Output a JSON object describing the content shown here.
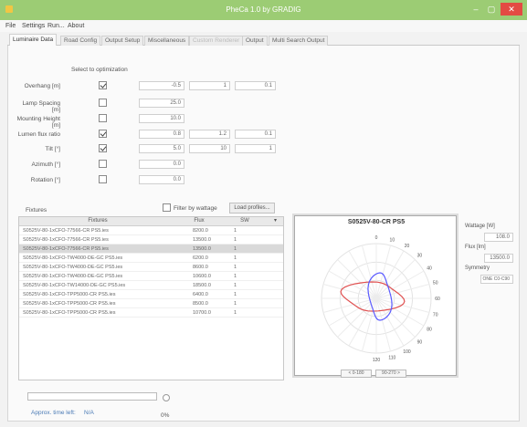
{
  "window": {
    "title": "PheCa 1.0 by GRADIG",
    "min_glyph": "–",
    "max_glyph": "▢",
    "close_glyph": "✕",
    "accent": "#9ccc74"
  },
  "menu": [
    "File",
    "Settings",
    "Run...",
    "About"
  ],
  "tabs": [
    {
      "label": "Luminaire Data",
      "active": true,
      "disabled": false
    },
    {
      "label": "Road Config",
      "active": false,
      "disabled": false
    },
    {
      "label": "Output Setup",
      "active": false,
      "disabled": false
    },
    {
      "label": "Miscellaneous",
      "active": false,
      "disabled": false
    },
    {
      "label": "Custom Renderer",
      "active": false,
      "disabled": true
    },
    {
      "label": "Output",
      "active": false,
      "disabled": false
    },
    {
      "label": "Multi Search Output",
      "active": false,
      "disabled": false
    }
  ],
  "form": {
    "select_label": "Select to optimization",
    "rows": [
      {
        "label": "Overhang [m]",
        "checked": true,
        "v1": "-0.5",
        "v2": "1",
        "v3": "0.1"
      },
      {
        "label": "Lamp Spacing [m]",
        "checked": false,
        "v1": "25.0",
        "v2": "",
        "v3": ""
      },
      {
        "label": "Mounting Height [m]",
        "checked": false,
        "v1": "10.0",
        "v2": "",
        "v3": ""
      },
      {
        "label": "Lumen flux ratio",
        "checked": true,
        "v1": "0.8",
        "v2": "1.2",
        "v3": "0.1"
      },
      {
        "label": "Tilt [°]",
        "checked": true,
        "v1": "5.0",
        "v2": "10",
        "v3": "1"
      },
      {
        "label": "Azimuth [°]",
        "checked": false,
        "v1": "0.0",
        "v2": "",
        "v3": ""
      },
      {
        "label": "Rotation [°]",
        "checked": false,
        "v1": "0.0",
        "v2": "",
        "v3": ""
      }
    ]
  },
  "fixtures": {
    "label": "Fixtures",
    "filter_label": "Filter by wattage",
    "load_button": "Load profiles...",
    "columns": [
      "Fixtures",
      "Flux",
      "SW",
      "▾"
    ],
    "rows": [
      {
        "name": "S0525V-80-1xCFO-77566-CR PS5.ies",
        "flux": "8200.0",
        "sw": "1",
        "selected": false
      },
      {
        "name": "S0525V-80-1xCFO-77566-CR PS5.ies",
        "flux": "13500.0",
        "sw": "1",
        "selected": false
      },
      {
        "name": "S0525V-80-1xCFO-77566-CR PS5.ies",
        "flux": "13500.0",
        "sw": "1",
        "selected": true
      },
      {
        "name": "S0525V-80-1xCFO-TW4000-DE-GC PS5.ies",
        "flux": "6200.0",
        "sw": "1",
        "selected": false
      },
      {
        "name": "S0525V-80-1xCFO-TW4000-DE-GC PS5.ies",
        "flux": "8600.0",
        "sw": "1",
        "selected": false
      },
      {
        "name": "S0525V-80-1xCFO-TW4000-DE-GC PS5.ies",
        "flux": "10600.0",
        "sw": "1",
        "selected": false
      },
      {
        "name": "S0525V-80-1xCFO-TW14000-DE-GC PS5.ies",
        "flux": "18500.0",
        "sw": "1",
        "selected": false
      },
      {
        "name": "S0525V-80-1xCFO-TPP5000-CR PS5.ies",
        "flux": "6400.0",
        "sw": "1",
        "selected": false
      },
      {
        "name": "S0525V-80-1xCFO-TPP5000-CR PS5.ies",
        "flux": "8500.0",
        "sw": "1",
        "selected": false
      },
      {
        "name": "S0525V-80-1xCFO-TPP5000-CR PS5.ies",
        "flux": "10700.0",
        "sw": "1",
        "selected": false
      }
    ]
  },
  "polar": {
    "title": "S0525V-80-CR PS5",
    "ticks": [
      "0",
      "10",
      "20",
      "30",
      "40",
      "50",
      "60",
      "70",
      "80",
      "90",
      "100",
      "110",
      "120"
    ],
    "series": [
      {
        "stroke": "#e05050"
      },
      {
        "stroke": "#5a5aff"
      }
    ],
    "prev_button": "< 0-180",
    "next_button": "90-270 >"
  },
  "right_info": {
    "wattage_label": "Wattage [W]",
    "wattage_value": "108.0",
    "flux_label": "Flux [lm]",
    "flux_value": "13500.0",
    "symmetry_label": "Symmetry",
    "symmetry_value": "ONE C0-C90"
  },
  "status": {
    "approx_label": "Approx. time left:",
    "approx_value": "N/A",
    "percent": "0%",
    "progress": 0
  }
}
